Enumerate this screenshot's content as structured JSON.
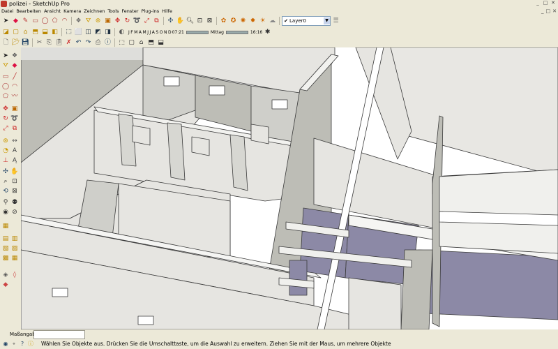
{
  "window": {
    "title": "polizei - SketchUp Pro",
    "controls": [
      "_",
      "□",
      "✕"
    ]
  },
  "menu": {
    "items": [
      "Datei",
      "Bearbeiten",
      "Ansicht",
      "Kamera",
      "Zeichnen",
      "Tools",
      "Fenster",
      "Plug-ins",
      "Hilfe"
    ],
    "doc_controls": [
      "_",
      "□",
      "✕"
    ]
  },
  "toolbar": {
    "layer": {
      "check": "✔",
      "value": "Layer0",
      "arrow": "▼"
    },
    "months": [
      "J",
      "F",
      "M",
      "A",
      "M",
      "J",
      "J",
      "A",
      "S",
      "O",
      "N",
      "D"
    ],
    "time_start": "07:21",
    "time_mid": "Mittag",
    "time_end": "16:16"
  },
  "statusbar": {
    "vcb_label": "Maßangaben",
    "vcb_value": "",
    "message": "Wählen Sie Objekte aus. Drücken Sie die Umschalttaste, um die Auswahl zu erweitern. Ziehen Sie mit der Maus, um mehrere Objekte"
  },
  "colors": {
    "chrome": "#ece9d8",
    "wall_face": "#e6e5e1",
    "wall_shadow": "#bdbdb6",
    "floor_shadow": "#8c89a6",
    "edge": "#3a3a3a"
  }
}
